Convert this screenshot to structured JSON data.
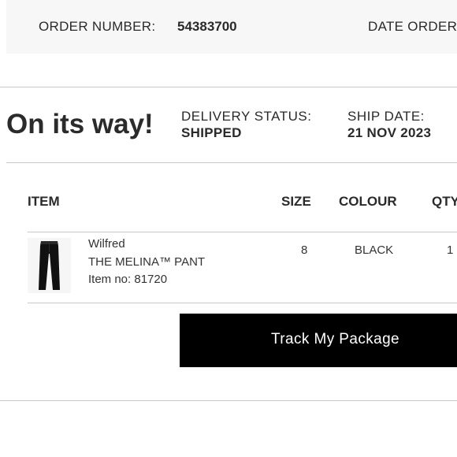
{
  "order": {
    "number_label": "ORDER NUMBER:",
    "number_value": "54383700",
    "date_label": "DATE ORDERED:"
  },
  "status": {
    "headline": "On its way!",
    "delivery_label": "DELIVERY STATUS:",
    "delivery_value": "SHIPPED",
    "ship_date_label": "SHIP DATE:",
    "ship_date_value": "21 NOV 2023"
  },
  "table": {
    "headers": {
      "item": "ITEM",
      "size": "SIZE",
      "colour": "COLOUR",
      "qty": "QTY"
    },
    "rows": [
      {
        "brand": "Wilfred",
        "name": "THE MELINA™ PANT",
        "item_no": "Item no: 81720",
        "size": "8",
        "colour": "BLACK",
        "qty": "1",
        "thumbnail_icon": "black-pants-icon"
      }
    ]
  },
  "actions": {
    "track_label": "Track My Package"
  },
  "colors": {
    "button_bg": "#000000",
    "strip_bg": "#f7f7f7",
    "rule": "#c8c8c8"
  }
}
